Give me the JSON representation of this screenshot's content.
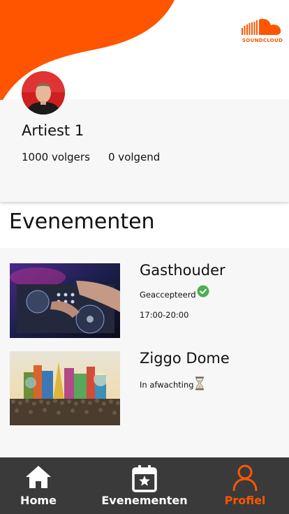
{
  "brand": {
    "logo_text": "SOUNDCLOUD",
    "accent": "#ff5500"
  },
  "profile": {
    "artist_name": "Artiest 1",
    "followers": "1000 volgers",
    "following": "0 volgend"
  },
  "events_section": {
    "title": "Evenementen",
    "items": [
      {
        "title": "Gasthouder",
        "status": "Geaccepteerd",
        "status_icon": "check-circle-icon",
        "time": "17:00-20:00"
      },
      {
        "title": "Ziggo Dome",
        "status": "In afwachting",
        "status_icon": "hourglass-icon"
      }
    ]
  },
  "nav": {
    "items": [
      {
        "label": "Home",
        "icon": "home-icon"
      },
      {
        "label": "Evenementen",
        "icon": "calendar-star-icon"
      },
      {
        "label": "Profiel",
        "icon": "user-icon",
        "active": true
      }
    ]
  }
}
